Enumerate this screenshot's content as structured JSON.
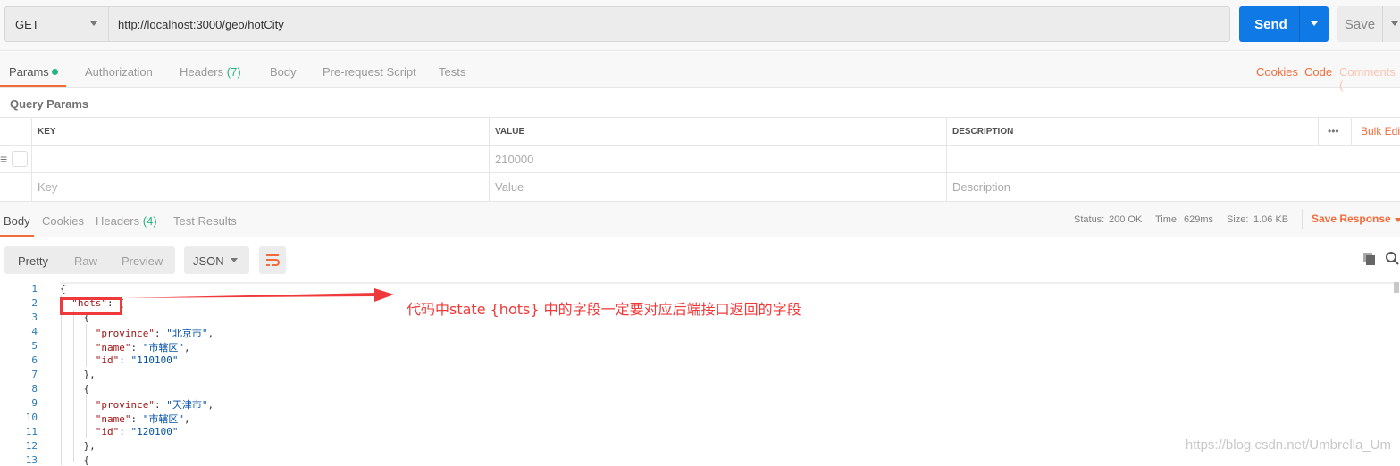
{
  "request": {
    "method": "GET",
    "url": "http://localhost:3000/geo/hotCity",
    "send_label": "Send",
    "save_label": "Save"
  },
  "request_tabs": [
    {
      "label": "Params"
    },
    {
      "label": "Authorization"
    },
    {
      "label": "Headers",
      "count": "(7)"
    },
    {
      "label": "Body"
    },
    {
      "label": "Pre-request Script"
    },
    {
      "label": "Tests"
    }
  ],
  "request_links": {
    "cookies": "Cookies",
    "code": "Code",
    "comments": "Comments ("
  },
  "query_params": {
    "title": "Query Params",
    "columns": [
      "KEY",
      "VALUE",
      "DESCRIPTION"
    ],
    "more": "•••",
    "bulk_edit": "Bulk Edi",
    "rows": [
      {
        "key": "",
        "value": "210000",
        "description": ""
      }
    ],
    "placeholders": {
      "key": "Key",
      "value": "Value",
      "description": "Description"
    }
  },
  "response_tabs": [
    {
      "label": "Body"
    },
    {
      "label": "Cookies"
    },
    {
      "label": "Headers",
      "count": "(4)"
    },
    {
      "label": "Test Results"
    }
  ],
  "response_status": {
    "status_label": "Status:",
    "status": "200 OK",
    "time_label": "Time:",
    "time": "629ms",
    "size_label": "Size:",
    "size": "1.06 KB",
    "save_response": "Save Response"
  },
  "view_modes": [
    "Pretty",
    "Raw",
    "Preview"
  ],
  "format": "JSON",
  "colors": {
    "accent": "#f26b3a",
    "send": "#0f7ae5",
    "success": "#26b47f",
    "annotation": "#f0393a"
  },
  "code_lines": [
    {
      "n": "1",
      "p": [
        [
          "",
          "{"
        ]
      ]
    },
    {
      "n": "2",
      "p": [
        [
          "",
          "  "
        ],
        [
          "k",
          "\"hots\""
        ],
        [
          "",
          ": ["
        ]
      ]
    },
    {
      "n": "3",
      "p": [
        [
          "",
          "    {"
        ]
      ]
    },
    {
      "n": "4",
      "p": [
        [
          "",
          "      "
        ],
        [
          "k",
          "\"province\""
        ],
        [
          "",
          ": "
        ],
        [
          "s",
          "\"北京市\""
        ],
        [
          "",
          ","
        ]
      ]
    },
    {
      "n": "5",
      "p": [
        [
          "",
          "      "
        ],
        [
          "k",
          "\"name\""
        ],
        [
          "",
          ": "
        ],
        [
          "s",
          "\"市辖区\""
        ],
        [
          "",
          ","
        ]
      ]
    },
    {
      "n": "6",
      "p": [
        [
          "",
          "      "
        ],
        [
          "k",
          "\"id\""
        ],
        [
          "",
          ": "
        ],
        [
          "s",
          "\"110100\""
        ]
      ]
    },
    {
      "n": "7",
      "p": [
        [
          "",
          "    },"
        ]
      ]
    },
    {
      "n": "8",
      "p": [
        [
          "",
          "    {"
        ]
      ]
    },
    {
      "n": "9",
      "p": [
        [
          "",
          "      "
        ],
        [
          "k",
          "\"province\""
        ],
        [
          "",
          ": "
        ],
        [
          "s",
          "\"天津市\""
        ],
        [
          "",
          ","
        ]
      ]
    },
    {
      "n": "10",
      "p": [
        [
          "",
          "      "
        ],
        [
          "k",
          "\"name\""
        ],
        [
          "",
          ": "
        ],
        [
          "s",
          "\"市辖区\""
        ],
        [
          "",
          ","
        ]
      ]
    },
    {
      "n": "11",
      "p": [
        [
          "",
          "      "
        ],
        [
          "k",
          "\"id\""
        ],
        [
          "",
          ": "
        ],
        [
          "s",
          "\"120100\""
        ]
      ]
    },
    {
      "n": "12",
      "p": [
        [
          "",
          "    },"
        ]
      ]
    },
    {
      "n": "13",
      "p": [
        [
          "",
          "    {"
        ]
      ]
    }
  ],
  "annotation": "代码中state {hots} 中的字段一定要对应后端接口返回的字段",
  "watermark": "https://blog.csdn.net/Umbrella_Um"
}
